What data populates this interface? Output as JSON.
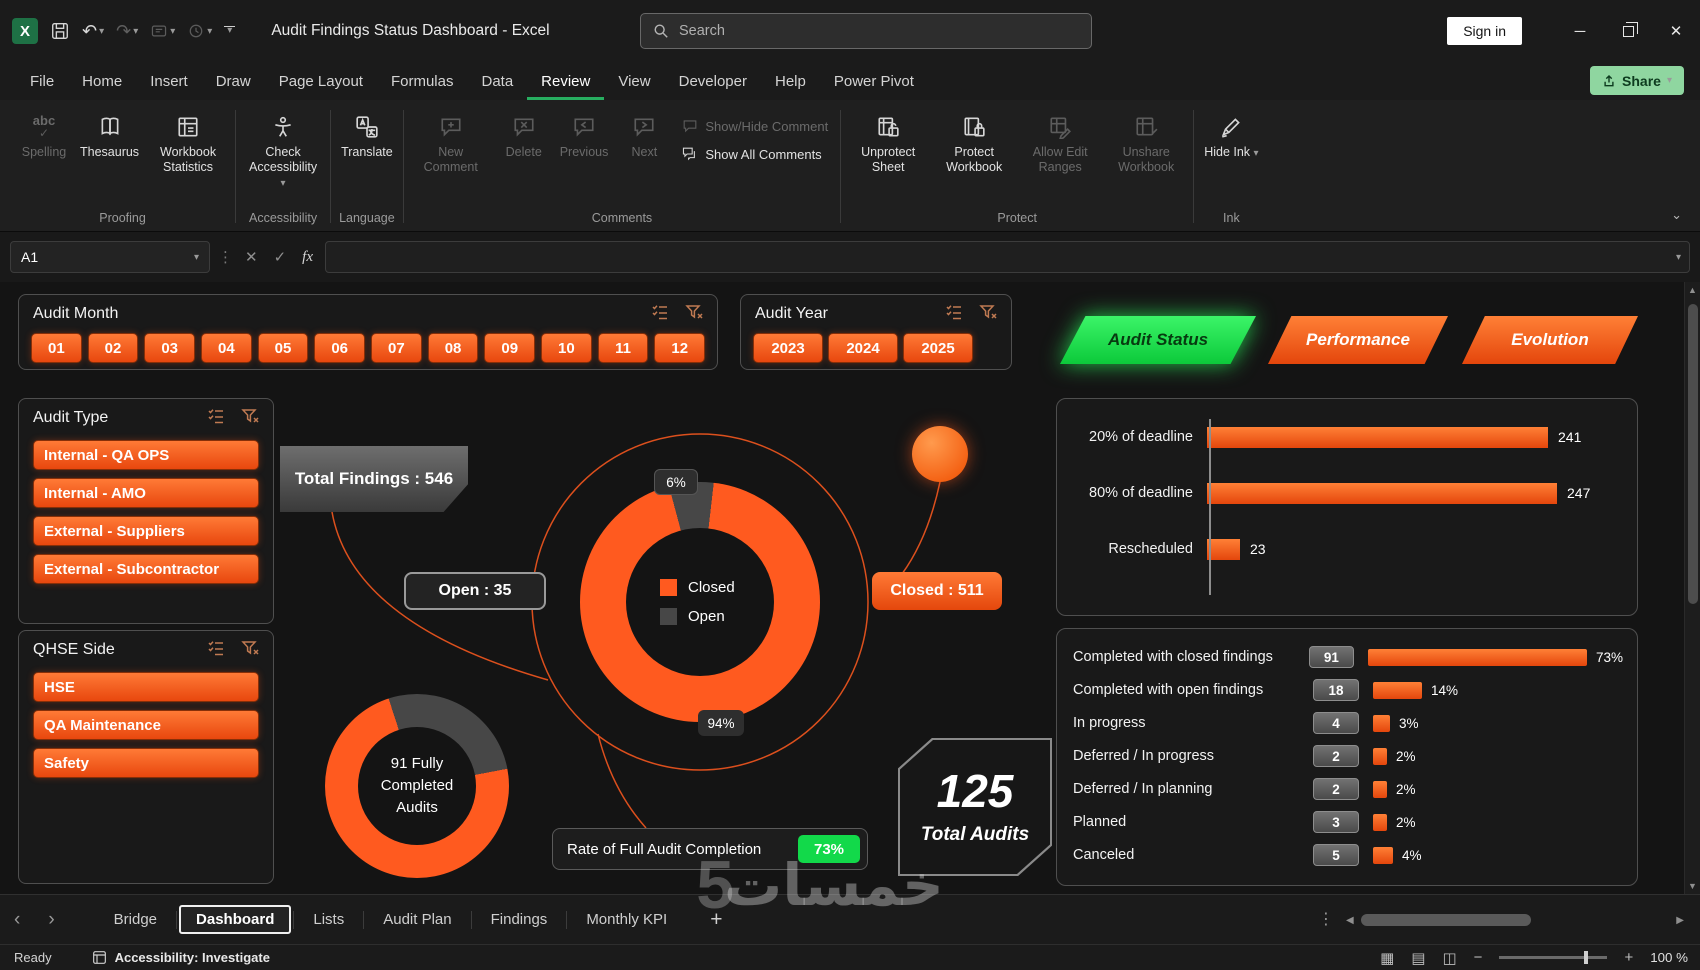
{
  "titlebar": {
    "app_title": "Audit Findings Status Dashboard  -  Excel",
    "search_placeholder": "Search",
    "sign_in_label": "Sign in"
  },
  "menubar": {
    "tabs": [
      "File",
      "Home",
      "Insert",
      "Draw",
      "Page Layout",
      "Formulas",
      "Data",
      "Review",
      "View",
      "Developer",
      "Help",
      "Power Pivot"
    ],
    "active_tab": "Review",
    "share_label": "Share"
  },
  "ribbon": {
    "spelling": "Spelling",
    "thesaurus": "Thesaurus",
    "workbook_statistics": "Workbook Statistics",
    "check_accessibility": "Check Accessibility",
    "translate": "Translate",
    "new_comment": "New Comment",
    "delete": "Delete",
    "previous": "Previous",
    "next": "Next",
    "show_hide_comment": "Show/Hide Comment",
    "show_all_comments": "Show All Comments",
    "unprotect_sheet": "Unprotect Sheet",
    "protect_workbook": "Protect Workbook",
    "allow_edit_ranges": "Allow Edit Ranges",
    "unshare_workbook": "Unshare Workbook",
    "hide_ink": "Hide Ink",
    "groups": {
      "proofing": "Proofing",
      "accessibility": "Accessibility",
      "language": "Language",
      "comments": "Comments",
      "protect": "Protect",
      "ink": "Ink"
    }
  },
  "formula_bar": {
    "name_box": "A1",
    "fx": "fx"
  },
  "dashboard": {
    "month_slicer": {
      "title": "Audit Month",
      "items": [
        "01",
        "02",
        "03",
        "04",
        "05",
        "06",
        "07",
        "08",
        "09",
        "10",
        "11",
        "12"
      ]
    },
    "year_slicer": {
      "title": "Audit Year",
      "items": [
        "2023",
        "2024",
        "2025"
      ]
    },
    "nav": {
      "audit_status": "Audit Status",
      "performance": "Performance",
      "evolution": "Evolution"
    },
    "type_slicer": {
      "title": "Audit Type",
      "items": [
        "Internal - QA OPS",
        "Internal - AMO",
        "External - Suppliers",
        "External - Subcontractor"
      ]
    },
    "qhse_slicer": {
      "title": "QHSE Side",
      "items": [
        "HSE",
        "QA Maintenance",
        "Safety"
      ]
    },
    "total_findings": "Total Findings : 546",
    "open_callout": "Open : 35",
    "closed_callout": "Closed : 511",
    "legend": {
      "closed": "Closed",
      "open": "Open"
    },
    "donut_labels": {
      "open_pct": "6%",
      "closed_pct": "94%"
    },
    "completed_donut_label": "91 Fully Completed Audits",
    "completion_rate": {
      "label": "Rate of Full Audit Completion",
      "value": "73%"
    },
    "total_audits": {
      "value": "125",
      "label": "Total Audits"
    }
  },
  "chart_data": [
    {
      "type": "pie",
      "name": "findings-status-donut",
      "slices": [
        {
          "label": "Closed",
          "value": 511,
          "pct": 94,
          "color": "#ff5a1f"
        },
        {
          "label": "Open",
          "value": 35,
          "pct": 6,
          "color": "#474747"
        }
      ],
      "total_label": "Total Findings : 546",
      "legend_position": "center"
    },
    {
      "type": "bar",
      "name": "deadline-compliance",
      "orientation": "horizontal",
      "categories": [
        "20% of deadline",
        "80% of deadline",
        "Rescheduled"
      ],
      "values": [
        241,
        247,
        23
      ],
      "xlim": [
        0,
        260
      ],
      "bar_color": "#ff5a1f",
      "grid": false
    },
    {
      "type": "bar",
      "name": "audit-progress-status",
      "orientation": "horizontal",
      "categories": [
        "Completed with closed findings",
        "Completed with open findings",
        "In progress",
        "Deferred / In progress",
        "Deferred / In planning",
        "Planned",
        "Canceled"
      ],
      "series": [
        {
          "name": "count",
          "values": [
            91,
            18,
            4,
            2,
            2,
            3,
            5
          ]
        },
        {
          "name": "percent",
          "values": [
            73,
            14,
            3,
            2,
            2,
            2,
            4
          ]
        }
      ],
      "pct_labels": [
        "73%",
        "14%",
        "3%",
        "2%",
        "2%",
        "2%",
        "4%"
      ],
      "bar_color": "#ff5a1f",
      "grid": false
    },
    {
      "type": "pie",
      "name": "fully-completed-audits-donut",
      "slices": [
        {
          "label": "Completed",
          "pct": 73,
          "color": "#ff5a1f"
        },
        {
          "label": "Remaining",
          "pct": 27,
          "color": "#474747"
        }
      ],
      "center_label": "91 Fully Completed Audits"
    }
  ],
  "sheet_tabs": {
    "items": [
      "Bridge",
      "Dashboard",
      "Lists",
      "Audit Plan",
      "Findings",
      "Monthly KPI"
    ],
    "active": "Dashboard"
  },
  "status_bar": {
    "ready": "Ready",
    "accessibility": "Accessibility: Investigate",
    "zoom": "100 %"
  },
  "watermark": {
    "text": "خمسات",
    "five": "5"
  },
  "colors": {
    "accent_orange": "#ff5a1f",
    "accent_orange_dark": "#e8470e",
    "accent_green": "#12d94a",
    "excel_green": "#27ae60"
  }
}
